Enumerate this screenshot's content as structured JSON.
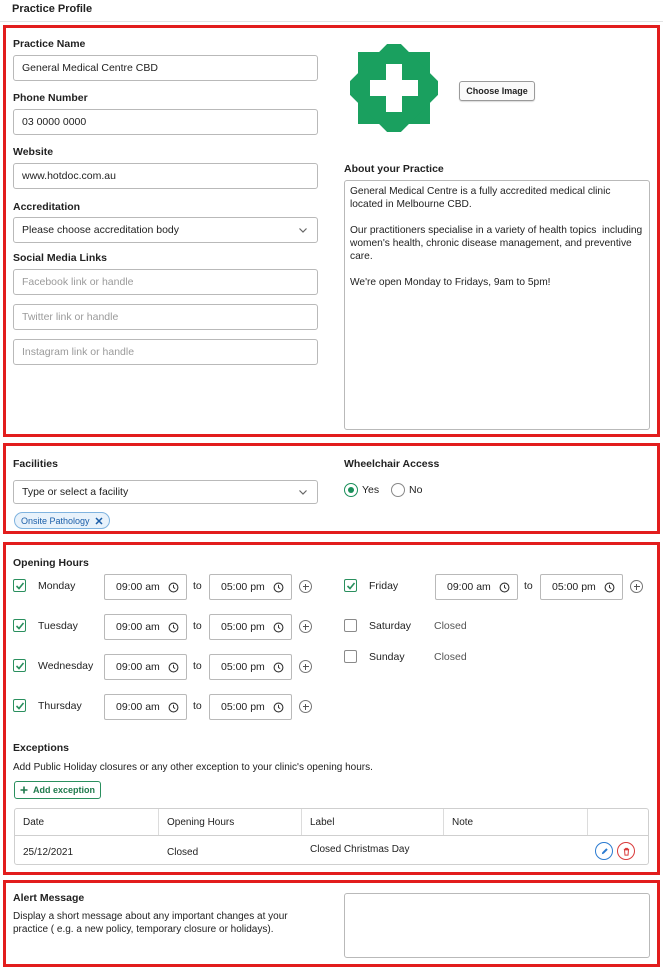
{
  "page_title": "Practice Profile",
  "practice": {
    "name_label": "Practice Name",
    "name_value": "General Medical Centre CBD",
    "phone_label": "Phone Number",
    "phone_value": "03 0000 0000",
    "website_label": "Website",
    "website_value": "www.hotdoc.com.au",
    "accreditation_label": "Accreditation",
    "accreditation_placeholder": "Please choose accreditation body",
    "social_label": "Social Media Links",
    "facebook_placeholder": "Facebook link or handle",
    "twitter_placeholder": "Twitter link or handle",
    "instagram_placeholder": "Instagram link or handle",
    "choose_image_label": "Choose Image",
    "logo_color": "#1aa05f",
    "about_label": "About your Practice",
    "about_text": "General Medical Centre is a fully accredited medical clinic located in Melbourne CBD.\n\nOur practitioners specialise in a variety of health topics  including women's health, chronic disease management, and preventive care.\n\nWe're open Monday to Fridays, 9am to 5pm!"
  },
  "facilities": {
    "label": "Facilities",
    "placeholder": "Type or select a facility",
    "chips": [
      "Onsite Pathology"
    ],
    "wheelchair_label": "Wheelchair Access",
    "yes_label": "Yes",
    "no_label": "No",
    "wheelchair_selected": "Yes"
  },
  "opening_hours": {
    "label": "Opening Hours",
    "to_label": "to",
    "days": [
      {
        "name": "Monday",
        "checked": true,
        "open": "09:00 am",
        "close": "05:00 pm"
      },
      {
        "name": "Tuesday",
        "checked": true,
        "open": "09:00 am",
        "close": "05:00 pm"
      },
      {
        "name": "Wednesday",
        "checked": true,
        "open": "09:00 am",
        "close": "05:00 pm"
      },
      {
        "name": "Thursday",
        "checked": true,
        "open": "09:00 am",
        "close": "05:00 pm"
      },
      {
        "name": "Friday",
        "checked": true,
        "open": "09:00 am",
        "close": "05:00 pm"
      },
      {
        "name": "Saturday",
        "checked": false,
        "status": "Closed"
      },
      {
        "name": "Sunday",
        "checked": false,
        "status": "Closed"
      }
    ]
  },
  "exceptions": {
    "label": "Exceptions",
    "description": "Add Public Holiday closures or any other exception to your clinic's opening hours.",
    "add_button": "Add exception",
    "columns": [
      "Date",
      "Opening Hours",
      "Label",
      "Note"
    ],
    "rows": [
      {
        "date": "25/12/2021",
        "hours": "Closed",
        "label": "Closed Christmas Day",
        "note": ""
      }
    ]
  },
  "alert": {
    "label": "Alert Message",
    "description": "Display a short message about any important changes at your practice ( e.g. a new policy, temporary closure or holidays).",
    "value": ""
  },
  "colors": {
    "highlight_border": "#e21d1d",
    "accent_green": "#2a8f5e",
    "edit_blue": "#2b7bd1",
    "delete_red": "#d93a3a"
  }
}
